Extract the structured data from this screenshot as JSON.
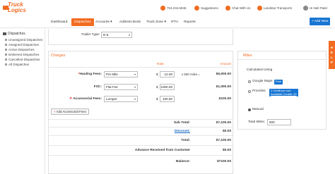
{
  "brand": {
    "logo_line1": "Truck",
    "logo_line2": "Logics",
    "accent": "#f26b21",
    "link_blue": "#1976d2"
  },
  "topbar": {
    "phone": "704.234.6946",
    "suggestions": "Suggestions",
    "chat": "Chat With Us",
    "company": "Landstar Transports",
    "user": "Hi Neil Patel"
  },
  "nav": {
    "items": [
      "Dashboard",
      "Dispatches",
      "Accounts",
      "Address Book",
      "Truck Zone",
      "IFTA",
      "Reports"
    ],
    "active": "Dispatches",
    "add_new": "+ Add New"
  },
  "sidebar": {
    "heading": "Dispatches",
    "items": [
      "Unassigned Dispatches",
      "Assigned Dispatches",
      "Active Dispatches",
      "Delivered Dispatches",
      "Cancelled Dispatches",
      "All Dispatches"
    ]
  },
  "trailer": {
    "label": "Trailer Type:",
    "value": "D-5"
  },
  "charges": {
    "title": "Charges",
    "col_rate": "Rate",
    "col_amount": "Amount",
    "rows": [
      {
        "label": "Hauling Fees:",
        "required": "*",
        "type": "Per Mile",
        "currency": "$",
        "rate": "12.00",
        "note": "x 500 miles =",
        "amount": "$6,000.00"
      },
      {
        "label": "FSC:",
        "type": "Flat Fee",
        "currency": "$",
        "rate": "1000.00",
        "amount": "$1,000.00"
      },
      {
        "label": "Accessorial Fees:",
        "remove": "✕",
        "type": "Lumper",
        "currency": "$",
        "rate": "100.00",
        "amount": "$100.00"
      }
    ],
    "add_button": "Add Accessorial Fees",
    "summary": [
      {
        "label": "Sub Total:",
        "value": "$7,100.00"
      },
      {
        "label": "Discount:",
        "value": "$0.00",
        "link": true
      },
      {
        "label": "Total:",
        "value": "$7,100.00"
      },
      {
        "label": "Advance Received from Customer",
        "value": "$0.00"
      },
      {
        "label": "Balance:",
        "value": "$7100.00"
      }
    ]
  },
  "miles": {
    "title": "Miles",
    "calculated_using": "Calculated Using",
    "options": [
      {
        "label": "Google Maps",
        "badge": "Free",
        "selected": false
      },
      {
        "label": "Promiles",
        "badge_line1": "1 Credit per use",
        "badge_line2": "Available Credits: 49",
        "selected": false
      },
      {
        "label": "Manual",
        "selected": true
      }
    ],
    "total_label": "Total Miles:",
    "total_value": "500"
  },
  "help_tab": [
    "H",
    "E",
    "L",
    "P"
  ]
}
